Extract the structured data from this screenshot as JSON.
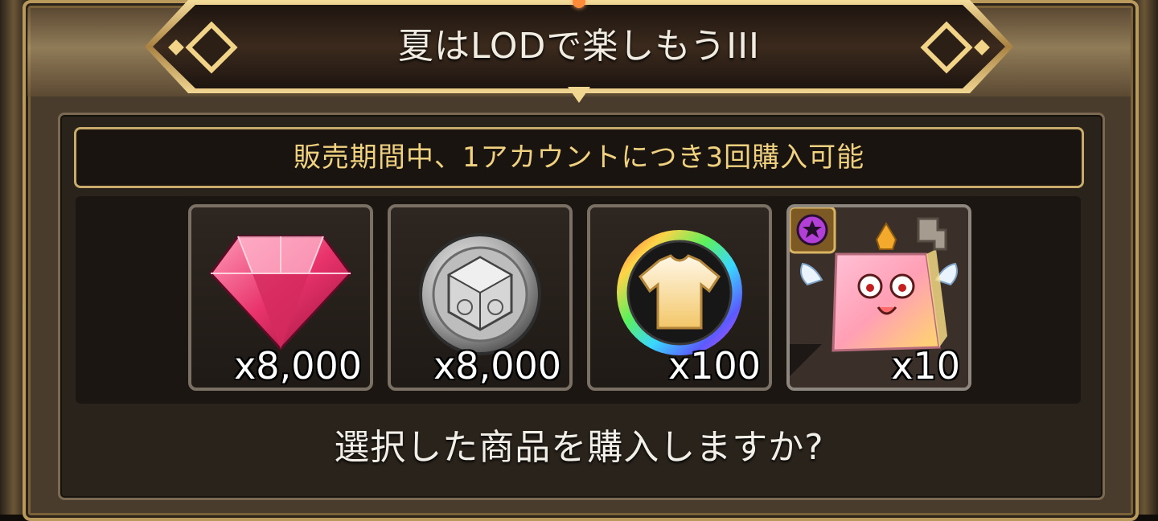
{
  "title": "夏はLODで楽しもうIII",
  "notice": "販売期間中、1アカウントにつき3回購入可能",
  "items": [
    {
      "name": "ruby-gem",
      "quantity": "x8,000"
    },
    {
      "name": "silver-cube-coin",
      "quantity": "x8,000"
    },
    {
      "name": "rainbow-shirt-token",
      "quantity": "x100"
    },
    {
      "name": "angel-cube-mascot",
      "quantity": "x10"
    }
  ],
  "question": "選択した商品を購入しますか?",
  "colors": {
    "frame_gold": "#c8aa6b",
    "notice_text": "#efd17f",
    "panel_bg": "#2a231c"
  }
}
